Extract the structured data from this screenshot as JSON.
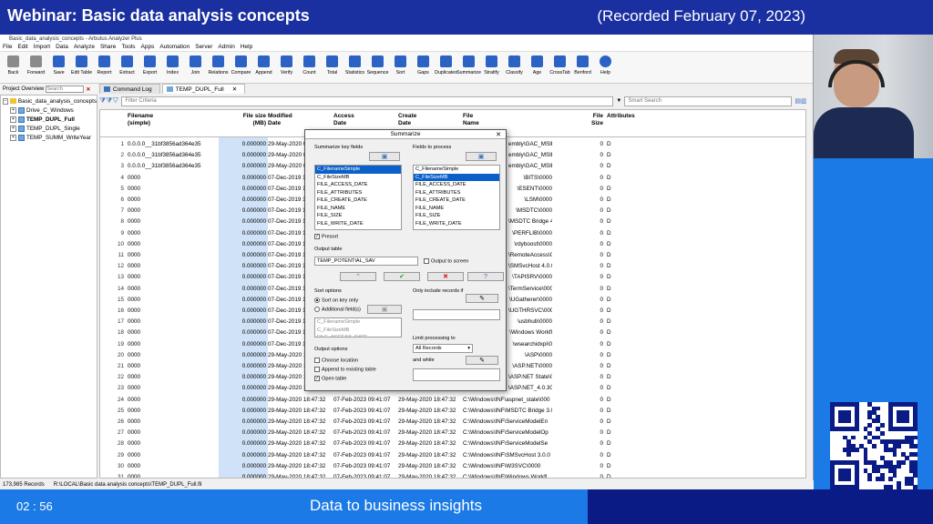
{
  "banner": {
    "title": "Webinar: Basic data analysis concepts",
    "recorded": "(Recorded February 07, 2023)"
  },
  "footer": {
    "time": "02 : 56",
    "tagline": "Data to business insights"
  },
  "app": {
    "window_title": "Basic_data_analysis_concepts - Arbutus Analyzer Plus",
    "menu": [
      "File",
      "Edit",
      "Import",
      "Data",
      "Analyze",
      "Share",
      "Tools",
      "Apps",
      "Automation",
      "Server",
      "Admin",
      "Help"
    ],
    "toolbar": [
      "Back",
      "Forward",
      "Save",
      "Edit Table",
      "Report",
      "Extract",
      "Export",
      "Index",
      "Join",
      "Relations",
      "Compare",
      "Append",
      "Verify",
      "Count",
      "Total",
      "Statistics",
      "Sequence",
      "Sort",
      "Gaps",
      "Duplicates",
      "Summarize",
      "Stratify",
      "Classify",
      "Age",
      "CrossTab",
      "Benford",
      "Help"
    ],
    "project_overview": {
      "label": "Project Overview",
      "search_placeholder": "Search"
    },
    "tree": [
      {
        "label": "Basic_data_analysis_concepts",
        "level": 0,
        "type": "root"
      },
      {
        "label": "Drive_C_Windows",
        "level": 1,
        "type": "table"
      },
      {
        "label": "TEMP_DUPL_Full",
        "level": 1,
        "type": "table",
        "bold": true
      },
      {
        "label": "TEMP_DUPL_Single",
        "level": 1,
        "type": "table"
      },
      {
        "label": "TEMP_SUMM_WriteYear",
        "level": 1,
        "type": "table"
      }
    ],
    "tabs": [
      "Command Log",
      "TEMP_DUPL_Full"
    ],
    "filter_placeholder": "Filter Criteria",
    "smart_search_placeholder": "Smart Search",
    "status": {
      "records": "173,985 Records",
      "path": "R:\\LOCAL\\Basic data analysis concepts\\TEMP_DUPL_Full.fil"
    }
  },
  "grid": {
    "headers": [
      "Filename\n(simple)",
      "File size\n(MB)",
      "Modified\nDate",
      "Access\nDate",
      "Create\nDate",
      "File\nName",
      "File\nSize",
      "Attributes"
    ],
    "rows": [
      [
        "1",
        "0.0.0.0__31bf3856ad364e35",
        "0.000000",
        "29-May-2020 0",
        "",
        "",
        "",
        "0",
        "D"
      ],
      [
        "2",
        "0.0.0.0__31bf3856ad364e35",
        "0.000000",
        "29-May-2020 0",
        "",
        "",
        "",
        "0",
        "D"
      ],
      [
        "3",
        "0.0.0.0__31bf3856ad364e35",
        "0.000000",
        "29-May-2020 0",
        "",
        "",
        "",
        "0",
        "D"
      ],
      [
        "4",
        "0000",
        "0.000000",
        "07-Dec-2019 10",
        "",
        "",
        "",
        "0",
        "D"
      ],
      [
        "5",
        "0000",
        "0.000000",
        "07-Dec-2019 10",
        "",
        "",
        "",
        "0",
        "D"
      ],
      [
        "6",
        "0000",
        "0.000000",
        "07-Dec-2019 10",
        "",
        "",
        "",
        "0",
        "D"
      ],
      [
        "7",
        "0000",
        "0.000000",
        "07-Dec-2019 10",
        "",
        "",
        "",
        "0",
        "D"
      ],
      [
        "8",
        "0000",
        "0.000000",
        "07-Dec-2019 10",
        "",
        "",
        "",
        "0",
        "D"
      ],
      [
        "9",
        "0000",
        "0.000000",
        "07-Dec-2019 10",
        "",
        "",
        "",
        "0",
        "D"
      ],
      [
        "10",
        "0000",
        "0.000000",
        "07-Dec-2019 10",
        "",
        "",
        "",
        "0",
        "D"
      ],
      [
        "11",
        "0000",
        "0.000000",
        "07-Dec-2019 10",
        "",
        "",
        "",
        "0",
        "D"
      ],
      [
        "12",
        "0000",
        "0.000000",
        "07-Dec-2019 10",
        "",
        "",
        "",
        "0",
        "D"
      ],
      [
        "13",
        "0000",
        "0.000000",
        "07-Dec-2019 10",
        "",
        "",
        "",
        "0",
        "D"
      ],
      [
        "14",
        "0000",
        "0.000000",
        "07-Dec-2019 10",
        "",
        "",
        "",
        "0",
        "D"
      ],
      [
        "15",
        "0000",
        "0.000000",
        "07-Dec-2019 10",
        "",
        "",
        "",
        "0",
        "D"
      ],
      [
        "16",
        "0000",
        "0.000000",
        "07-Dec-2019 10",
        "",
        "",
        "",
        "0",
        "D"
      ],
      [
        "17",
        "0000",
        "0.000000",
        "07-Dec-2019 10",
        "",
        "",
        "",
        "0",
        "D"
      ],
      [
        "18",
        "0000",
        "0.000000",
        "07-Dec-2019 10",
        "",
        "",
        "",
        "0",
        "D"
      ],
      [
        "19",
        "0000",
        "0.000000",
        "07-Dec-2019 10",
        "",
        "",
        "",
        "0",
        "D"
      ],
      [
        "20",
        "0000",
        "0.000000",
        "29-May-2020 18",
        "",
        "",
        "",
        "0",
        "D"
      ],
      [
        "21",
        "0000",
        "0.000000",
        "29-May-2020 18",
        "",
        "",
        "",
        "0",
        "D"
      ],
      [
        "22",
        "0000",
        "0.000000",
        "29-May-2020 18",
        "",
        "",
        "",
        "0",
        "D"
      ],
      [
        "23",
        "0000",
        "0.000000",
        "29-May-2020 18",
        "",
        "",
        "",
        "0",
        "D"
      ],
      [
        "24",
        "0000",
        "0.000000",
        "29-May-2020 18:47:32",
        "07-Feb-2023 09:41:07",
        "29-May-2020 18:47:32",
        "C:\\Windows\\INF\\aspnet_state\\000",
        "0",
        "D"
      ],
      [
        "25",
        "0000",
        "0.000000",
        "29-May-2020 18:47:32",
        "07-Feb-2023 09:41:07",
        "29-May-2020 18:47:32",
        "C:\\Windows\\INF\\MSDTC Bridge 3.0",
        "0",
        "D"
      ],
      [
        "26",
        "0000",
        "0.000000",
        "29-May-2020 18:47:32",
        "07-Feb-2023 09:41:07",
        "29-May-2020 18:47:32",
        "C:\\Windows\\INF\\ServiceModelEn",
        "0",
        "D"
      ],
      [
        "27",
        "0000",
        "0.000000",
        "29-May-2020 18:47:32",
        "07-Feb-2023 09:41:07",
        "29-May-2020 18:47:32",
        "C:\\Windows\\INF\\ServiceModelOp",
        "0",
        "D"
      ],
      [
        "28",
        "0000",
        "0.000000",
        "29-May-2020 18:47:32",
        "07-Feb-2023 09:41:07",
        "29-May-2020 18:47:32",
        "C:\\Windows\\INF\\ServiceModelSe",
        "0",
        "D"
      ],
      [
        "29",
        "0000",
        "0.000000",
        "29-May-2020 18:47:32",
        "07-Feb-2023 09:41:07",
        "29-May-2020 18:47:32",
        "C:\\Windows\\INF\\SMSvcHost 3.0.0",
        "0",
        "D"
      ],
      [
        "30",
        "0000",
        "0.000000",
        "29-May-2020 18:47:32",
        "07-Feb-2023 09:41:07",
        "29-May-2020 18:47:32",
        "C:\\Windows\\INF\\W3SVC\\0000",
        "0",
        "D"
      ],
      [
        "31",
        "0000",
        "0.000000",
        "29-May-2020 18:47:32",
        "07-Feb-2023 09:41:07",
        "29-May-2020 18:47:32",
        "C:\\Windows\\INF\\Windows Workfl",
        "0",
        "D"
      ]
    ],
    "right_fragments": [
      "embly\\GAC_MSIL\\",
      "embly\\GAC_MSIL\\",
      "embly\\GAC_MSIL\\",
      "\\BITS\\0000",
      "\\ESENT\\0000",
      "\\LSM\\0000",
      "\\MSDTC\\0000",
      "\\MSDTC Bridge 4.0",
      "\\PERFLIB\\0000",
      "\\rdyboost\\0000",
      "\\RemoteAccess\\0",
      "\\SMSvcHost 4.0.0",
      "\\TAPISRV\\0000",
      "\\TermService\\000",
      "\\UGatherer\\0000",
      "\\UGTHRSVC\\0000",
      "\\usbhub\\0000",
      "\\Windows Workfl",
      "\\wsearchidxpi\\0",
      "\\ASP\\0000",
      "\\ASP.NET\\0000",
      "\\ASP.NET State\\0",
      "\\ASP.NET_4.0.303"
    ]
  },
  "dialog": {
    "title": "Summarize",
    "key_fields_label": "Summarize key fields",
    "fields_to_process_label": "Fields to process",
    "key_fields": [
      "C_FilenameSimple",
      "C_FileSizeMB",
      "FILE_ACCESS_DATE",
      "FILE_ATTRIBUTES",
      "FILE_CREATE_DATE",
      "FILE_NAME",
      "FILE_SIZE",
      "FILE_WRITE_DATE"
    ],
    "process_fields": [
      "C_FilenameSimple",
      "C_FileSizeMB",
      "FILE_ACCESS_DATE",
      "FILE_ATTRIBUTES",
      "FILE_CREATE_DATE",
      "FILE_NAME",
      "FILE_SIZE",
      "FILE_WRITE_DATE"
    ],
    "presort": "Presort",
    "output_table_label": "Output table",
    "output_table_value": "TEMP_POTENTIAL_SAV",
    "output_to_screen": "Output to screen",
    "sort_options": "Sort options",
    "sort_key_only": "Sort on key only",
    "additional_fields": "Additional field(s)",
    "additional_list": [
      "C_FilenameSimple",
      "C_FileSizeMB",
      "FILE_ACCESS_DATE"
    ],
    "only_include": "Only include records if",
    "output_options": "Output options",
    "choose_location": "Choose location",
    "append_existing": "Append to existing table",
    "open_table": "Open table",
    "limit_processing": "Limit processing to",
    "limit_value": "All Records",
    "and_while": "and while"
  },
  "colors": {
    "banner": "#1a2fa0",
    "accent": "#1b7ae6",
    "dark": "#0a1b85",
    "size_col": "#cfe2f7"
  }
}
